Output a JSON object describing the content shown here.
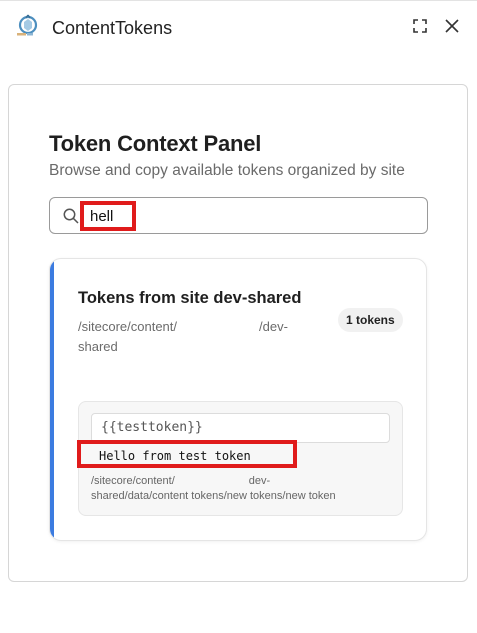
{
  "header": {
    "app_title": "ContentTokens",
    "logo_icon": "app-logo-icon",
    "expand_icon": "expand-icon",
    "close_icon": "close-icon"
  },
  "panel": {
    "title": "Token Context Panel",
    "subtitle": "Browse and copy available tokens organized by site"
  },
  "search": {
    "value": "hell",
    "icon": "search-icon"
  },
  "sites": [
    {
      "title": "Tokens from site dev-shared",
      "path_part1": "/sitecore/content/",
      "path_part2": "/dev-",
      "path_part3": "shared",
      "count_label": "1 tokens",
      "tokens": [
        {
          "key": "{{testtoken}}",
          "value": "Hello from test token",
          "path_part1": "/sitecore/content/",
          "path_part2": "dev-",
          "path_part3": "shared/data/content tokens/new tokens/new token"
        }
      ]
    }
  ],
  "colors": {
    "accent": "#3b7be0",
    "highlight": "#e01b1b"
  }
}
